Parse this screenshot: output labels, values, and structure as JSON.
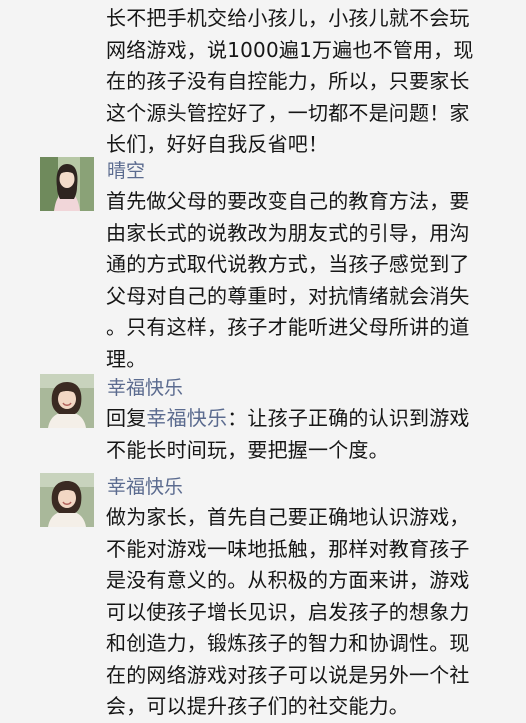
{
  "comments": [
    {
      "lines": [
        "长不把手机交给小孩儿，小孩儿就不会玩",
        "网络游戏，说1000遍1万遍也不管用，现",
        "在的孩子没有自控能力，所以，只要家长",
        "这个源头管控好了，一切都不是问题！家",
        "长们，好好自我反省吧！"
      ]
    },
    {
      "author": "晴空",
      "lines": [
        "首先做父母的要改变自己的教育方法，要",
        "由家长式的说教改为朋友式的引导，用沟",
        "通的方式取代说教方式，当孩子感觉到了",
        "父母对自己的尊重时，对抗情绪就会消失",
        "。只有这样，孩子才能听进父母所讲的道",
        "理。"
      ]
    },
    {
      "author": "幸福快乐",
      "reply_prefix": "回复",
      "reply_to": "幸福快乐",
      "reply_rest": "：让孩子正确的认识到游戏",
      "lines": [
        "不能长时间玩，要把握一个度。"
      ]
    },
    {
      "author": "幸福快乐",
      "lines": [
        "做为家长，首先自己要正确地认识游戏，",
        "不能对游戏一味地抵触，那样对教育孩子",
        "是没有意义的。从积极的方面来讲，游戏",
        "可以使孩子增长见识，启发孩子的想象力",
        "和创造力，锻炼孩子的智力和协调性。现",
        "在的网络游戏对孩子可以说是另外一个社",
        "会，可以提升孩子们的社交能力。"
      ]
    }
  ]
}
